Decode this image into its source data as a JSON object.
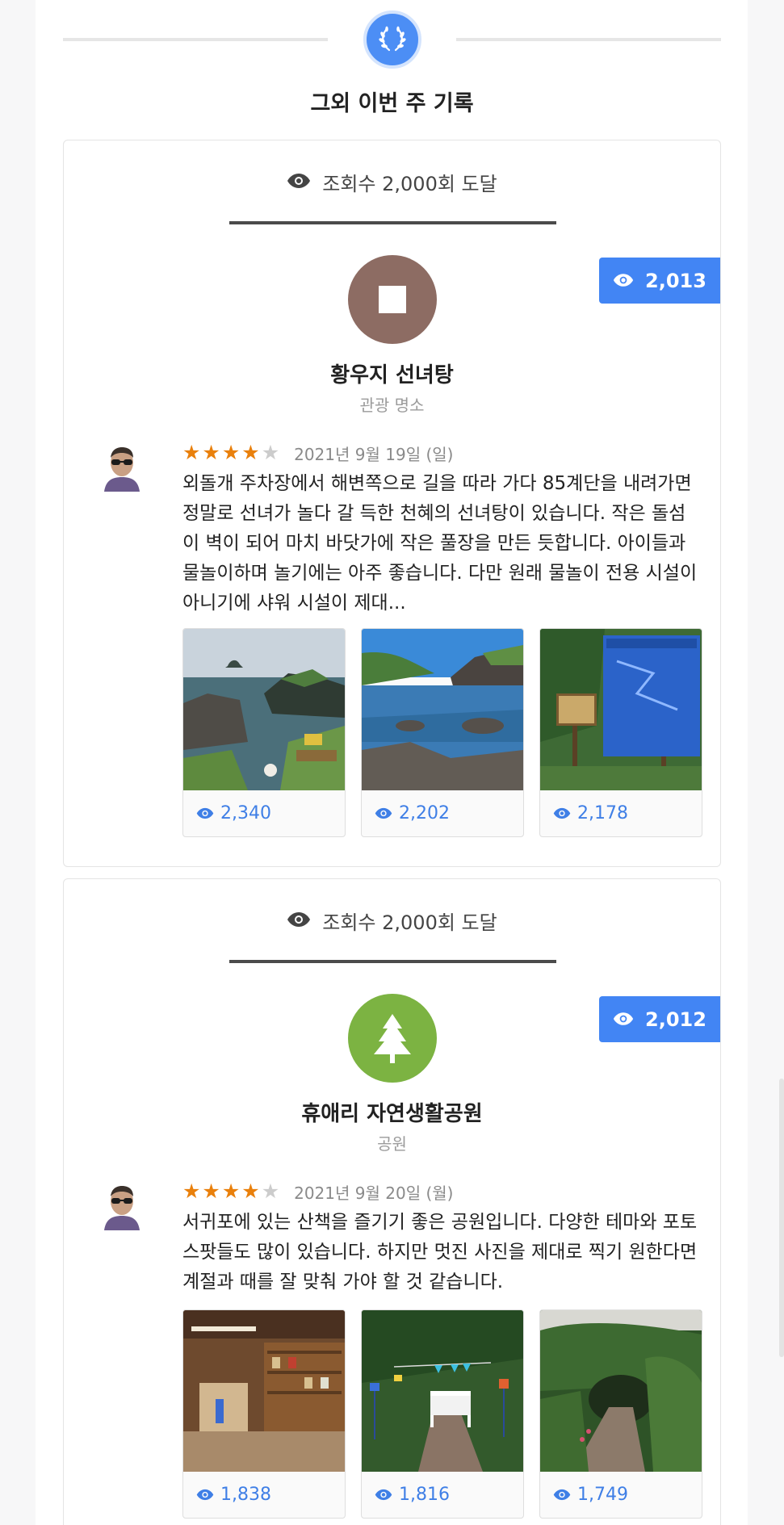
{
  "header": {
    "title": "그외 이번 주 기록",
    "icon": "laurel-icon"
  },
  "cards": [
    {
      "milestone": "조회수 2,000회 도달",
      "views": "2,013",
      "place": {
        "name": "황우지 선녀탕",
        "category": "관광 명소",
        "icon": "square-stop-icon",
        "color": "#8d6c63"
      },
      "review": {
        "rating": 4,
        "date": "2021년 9월 19일 (일)",
        "text": "외돌개 주차장에서 해변쪽으로 길을 따라 가다 85계단을 내려가면 정말로 선녀가 놀다 갈 득한 천혜의 선녀탕이 있습니다. 작은 돌섬이 벽이 되어 마치 바닷가에 작은 풀장을 만든 듯합니다. 아이들과 물놀이하며 놀기에는 아주 좋습니다. 다만 원래 물놀이 전용 시설이 아니기에 샤워 시설이 제대..."
      },
      "photos": [
        {
          "views": "2,340",
          "scene": "sea-rocks"
        },
        {
          "views": "2,202",
          "scene": "cove"
        },
        {
          "views": "2,178",
          "scene": "signboard"
        }
      ]
    },
    {
      "milestone": "조회수 2,000회 도달",
      "views": "2,012",
      "place": {
        "name": "휴애리 자연생활공원",
        "category": "공원",
        "icon": "tree-icon",
        "color": "#7cb342"
      },
      "review": {
        "rating": 4,
        "date": "2021년 9월 20일 (월)",
        "text": "서귀포에 있는 산책을 즐기기 좋은 공원입니다. 다양한 테마와 포토 스팟들도 많이 있습니다. 하지만 멋진 사진을 제대로 찍기 원한다면 계절과 때를 잘 맞춰 가야 할 것 같습니다."
      },
      "photos": [
        {
          "views": "1,838",
          "scene": "shop"
        },
        {
          "views": "1,816",
          "scene": "garden-bench"
        },
        {
          "views": "1,749",
          "scene": "forest-path"
        }
      ]
    }
  ]
}
